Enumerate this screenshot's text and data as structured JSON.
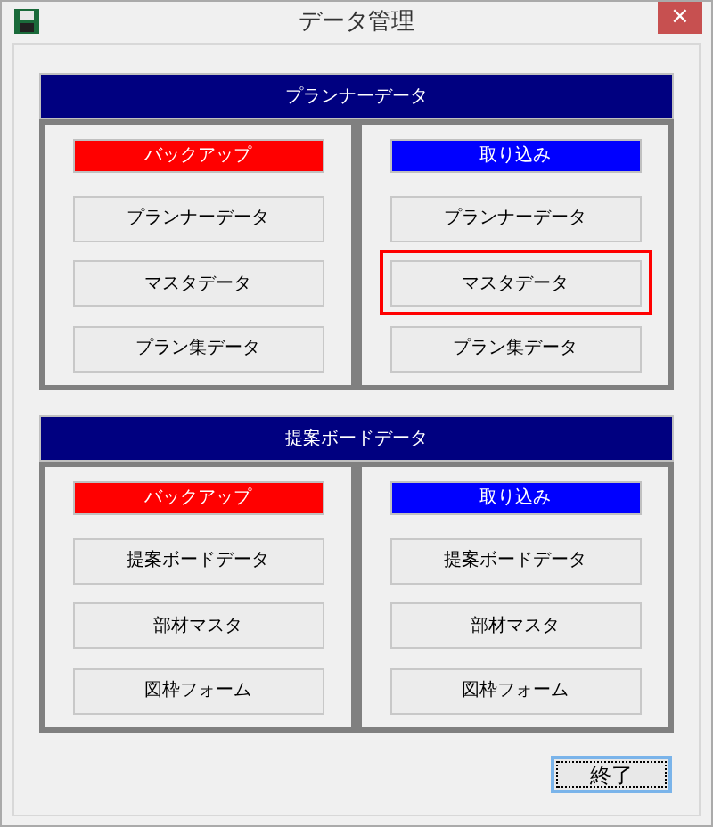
{
  "window": {
    "title": "データ管理",
    "close": "×"
  },
  "sections": [
    {
      "title": "プランナーデータ",
      "groups": [
        {
          "label": "バックアップ",
          "color": "#ff0000",
          "buttons": [
            {
              "label": "プランナーデータ",
              "highlighted": false
            },
            {
              "label": "マスタデータ",
              "highlighted": false
            },
            {
              "label": "プラン集データ",
              "highlighted": false
            }
          ]
        },
        {
          "label": "取り込み",
          "color": "#0000ff",
          "buttons": [
            {
              "label": "プランナーデータ",
              "highlighted": false
            },
            {
              "label": "マスタデータ",
              "highlighted": true
            },
            {
              "label": "プラン集データ",
              "highlighted": false
            }
          ]
        }
      ]
    },
    {
      "title": "提案ボードデータ",
      "groups": [
        {
          "label": "バックアップ",
          "color": "#ff0000",
          "buttons": [
            {
              "label": "提案ボードデータ",
              "highlighted": false
            },
            {
              "label": "部材マスタ",
              "highlighted": false
            },
            {
              "label": "図枠フォーム",
              "highlighted": false
            }
          ]
        },
        {
          "label": "取り込み",
          "color": "#0000ff",
          "buttons": [
            {
              "label": "提案ボードデータ",
              "highlighted": false
            },
            {
              "label": "部材マスタ",
              "highlighted": false
            },
            {
              "label": "図枠フォーム",
              "highlighted": false
            }
          ]
        }
      ]
    }
  ],
  "exit_button": {
    "label": "終了",
    "focused": true
  }
}
